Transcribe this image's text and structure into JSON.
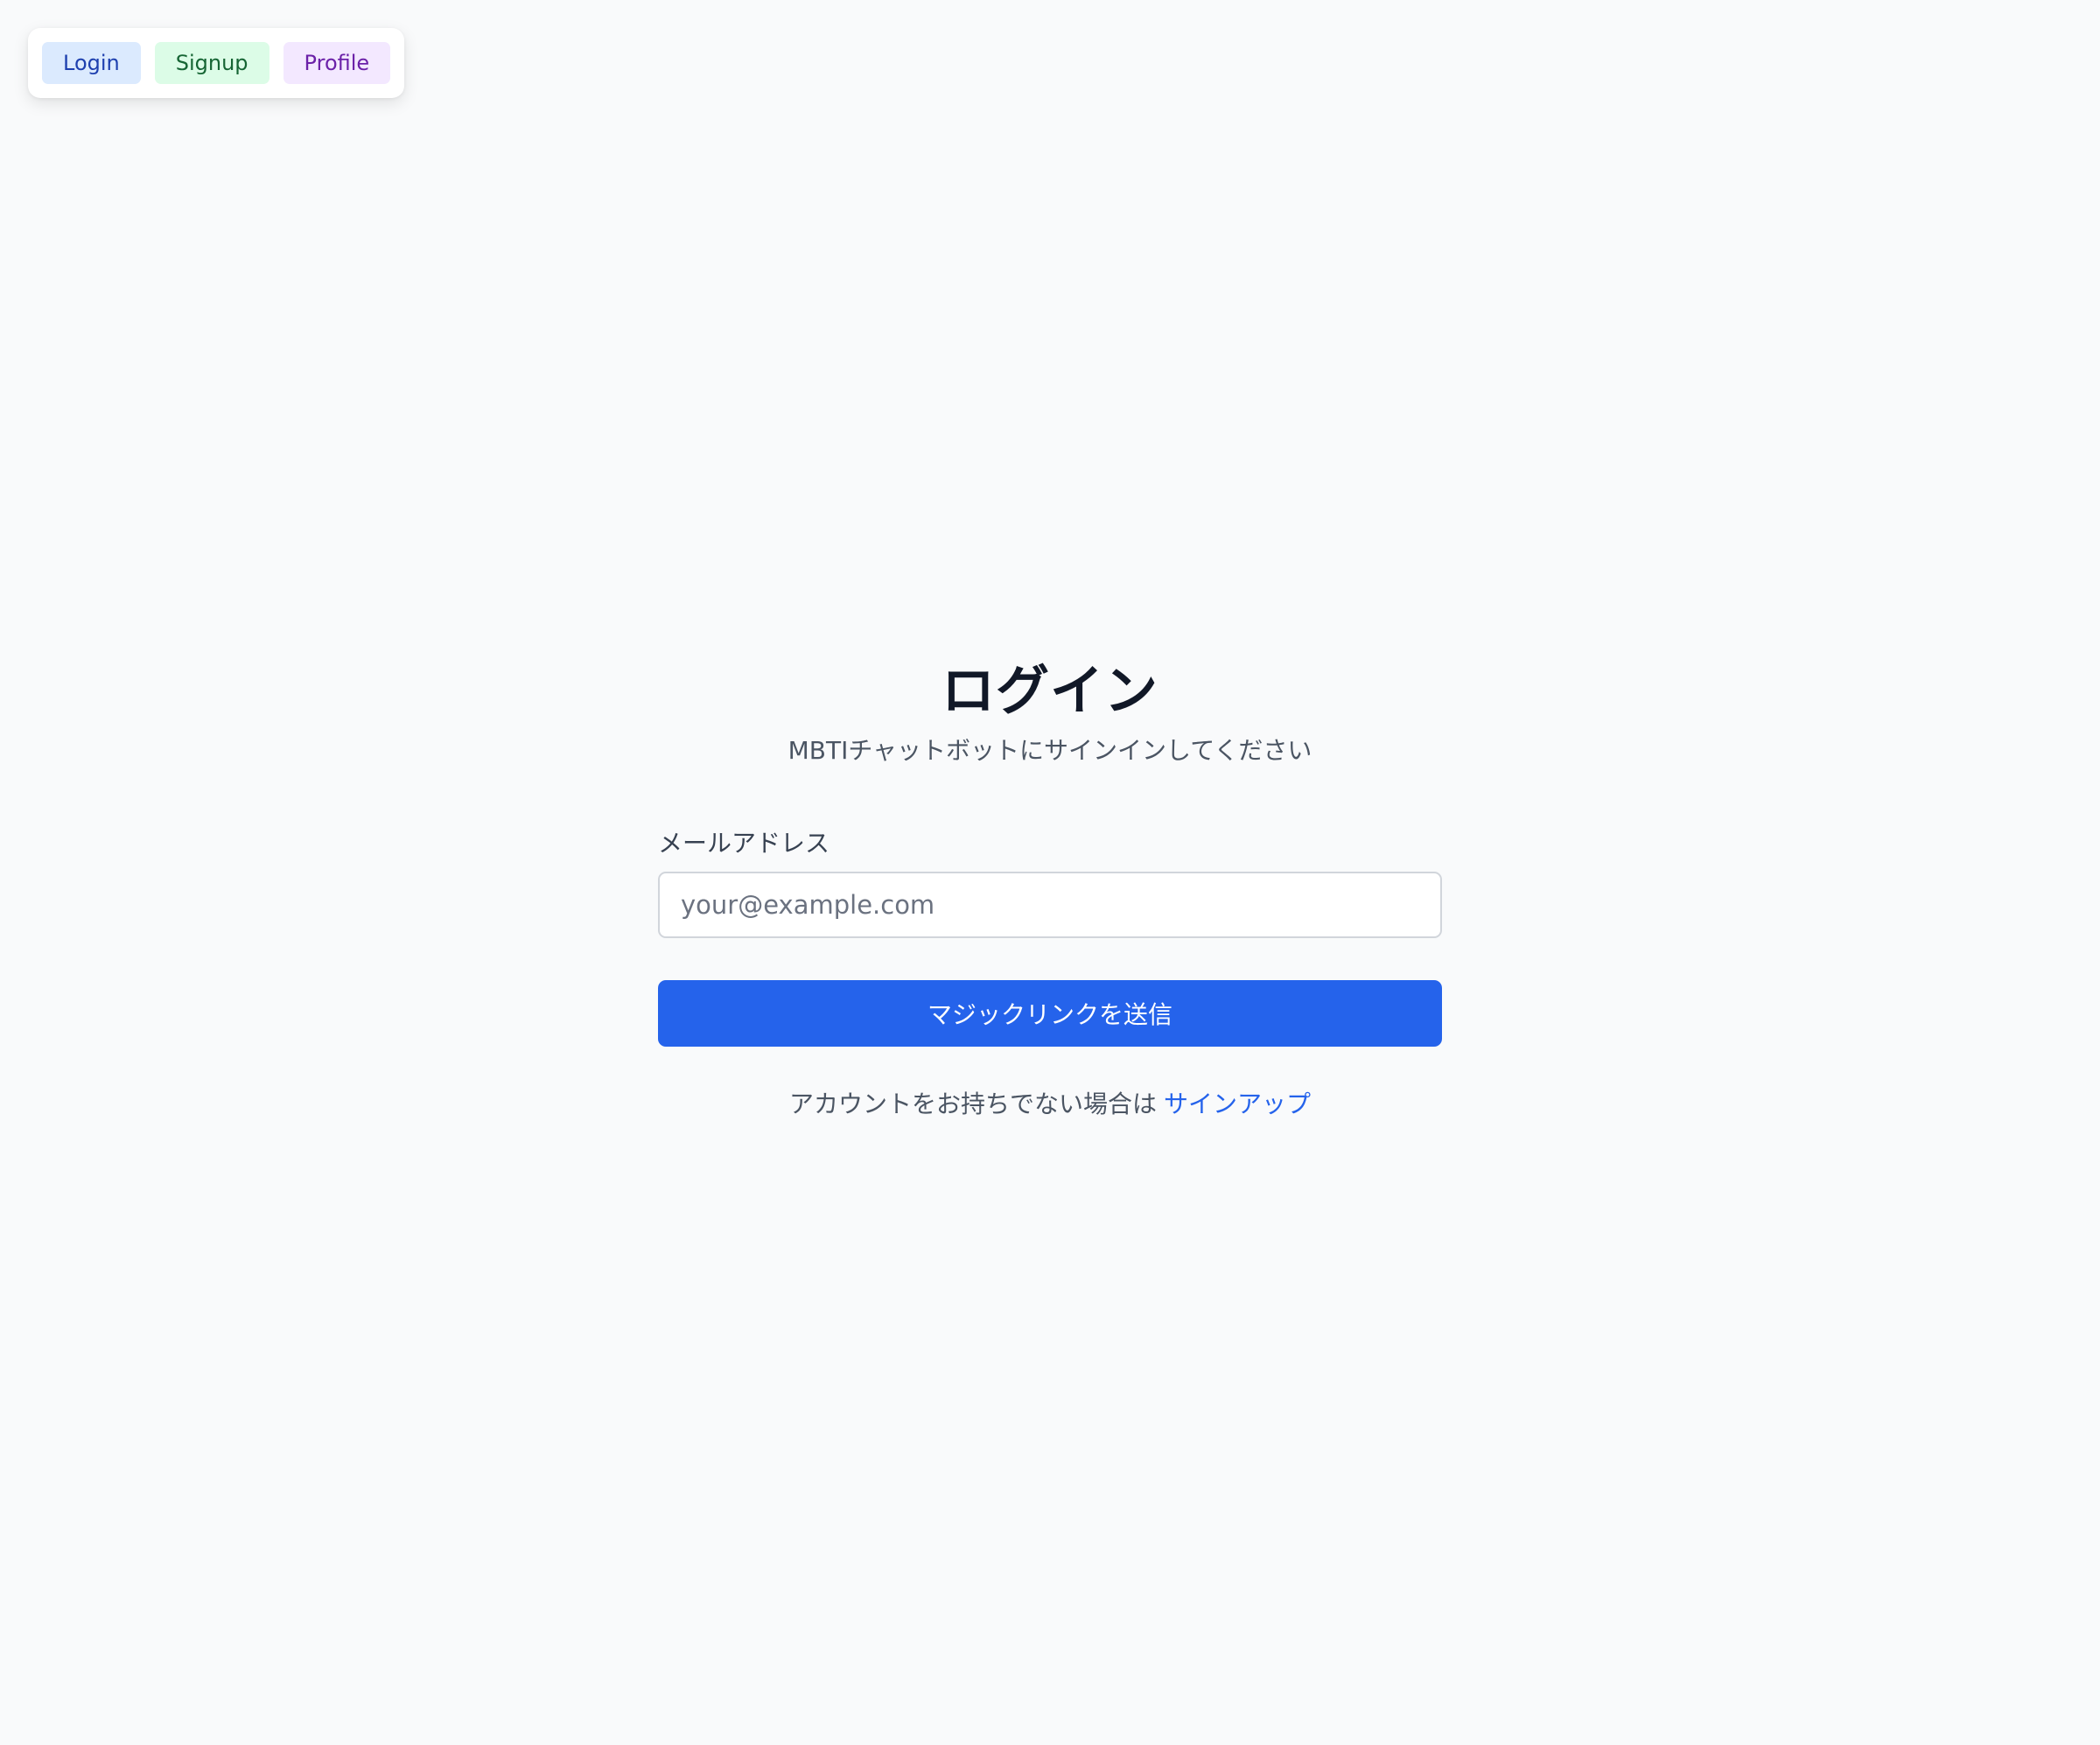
{
  "dev_nav": {
    "login_label": "Login",
    "signup_label": "Signup",
    "profile_label": "Profile"
  },
  "login": {
    "title": "ログイン",
    "subtitle": "MBTIチャットボットにサインインしてください",
    "email_label": "メールアドレス",
    "email_value": "",
    "email_placeholder": "your@example.com",
    "submit_label": "マジックリンクを送信",
    "no_account_text": "アカウントをお持ちでない場合は",
    "signup_link_label": "サインアップ"
  },
  "colors": {
    "background": "#f9fafb",
    "primary": "#2563eb",
    "nav_login_bg": "#dbeafe",
    "nav_signup_bg": "#dcfce7",
    "nav_profile_bg": "#f3e8ff"
  }
}
